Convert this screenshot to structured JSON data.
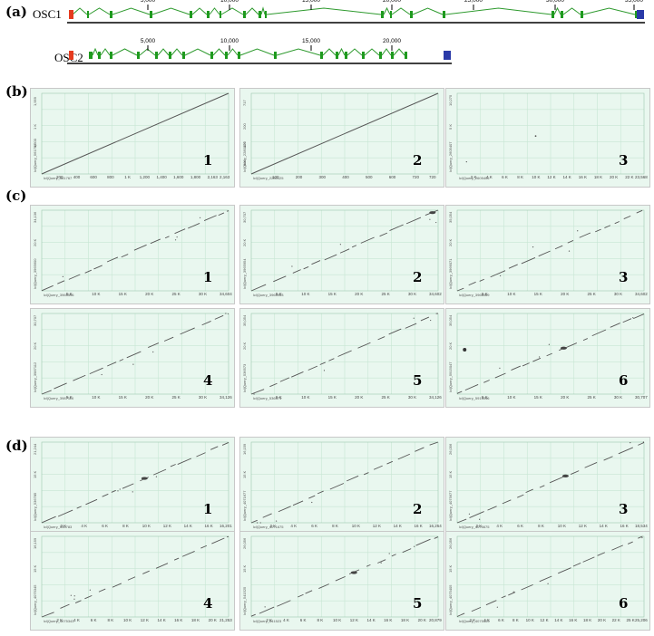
{
  "panels": {
    "a": "(a)",
    "b": "(b)",
    "c": "(c)",
    "d": "(d)"
  },
  "colors": {
    "exon": "#1e9a1e",
    "intron": "#2e9a2e",
    "start": "#e53a1e",
    "end": "#2a3aa8",
    "plot_bg": "#e9f7ef",
    "grid": "#c7e6d3",
    "line": "#555555"
  },
  "genes": [
    {
      "name": "OSC1",
      "ticks": [
        "5,000",
        "10,000",
        "15,000",
        "20,000",
        "25,000",
        "30,000",
        "35,000"
      ]
    },
    {
      "name": "OSC2",
      "ticks": [
        "5,000",
        "10,000",
        "15,000",
        "20,000"
      ]
    }
  ],
  "dotplots": {
    "b": [
      {
        "num": "1",
        "xlabel": "lcl|Query_561767",
        "ylabel": "lcl|Query_561768",
        "xmax": "2,163",
        "ymax": "1,959",
        "xticks": [
          "200",
          "400",
          "600",
          "800",
          "1 K",
          "1,200",
          "1,400",
          "1,600",
          "1,800",
          "2,163"
        ],
        "yticks": [
          "1 K",
          "1,500"
        ],
        "type": "diag"
      },
      {
        "num": "2",
        "xlabel": "lcl|Query_2280125",
        "ylabel": "lcl|Query_2280127",
        "xmax": "720",
        "ymax": "717",
        "xticks": [
          "100",
          "200",
          "300",
          "400",
          "500",
          "600",
          "720"
        ],
        "yticks": [
          "200",
          "400",
          "600"
        ],
        "type": "diag"
      },
      {
        "num": "3",
        "xlabel": "lcl|Query_2605406",
        "ylabel": "lcl|Query_2605407",
        "xmax": "23,568",
        "ymax": "10,275",
        "xticks": [
          "2 K",
          "4 K",
          "6 K",
          "8 K",
          "10 K",
          "12 K",
          "14 K",
          "16 K",
          "18 K",
          "20 K",
          "22 K"
        ],
        "yticks": [
          "5 K"
        ],
        "type": "sparse"
      }
    ],
    "c": [
      {
        "num": "1",
        "xlabel": "lcl|Query_3965596",
        "ylabel": "lcl|Query_3965600",
        "xmax": "34,604",
        "ymax": "34,136",
        "xticks": [
          "5 K",
          "10 K",
          "15 K",
          "20 K",
          "25 K",
          "30 K"
        ],
        "yticks": [
          "20 K"
        ],
        "type": "frag"
      },
      {
        "num": "2",
        "xlabel": "lcl|Query_3965953",
        "ylabel": "lcl|Query_3965954",
        "xmax": "34,602",
        "ymax": "30,707",
        "xticks": [
          "5 K",
          "10 K",
          "15 K",
          "20 K",
          "25 K",
          "30 K"
        ],
        "yticks": [
          "20 K"
        ],
        "type": "frag"
      },
      {
        "num": "3",
        "xlabel": "lcl|Query_3966069",
        "ylabel": "lcl|Query_3966071",
        "xmax": "34,602",
        "ymax": "35,054",
        "xticks": [
          "5 K",
          "10 K",
          "15 K",
          "20 K",
          "25 K",
          "30 K"
        ],
        "yticks": [
          "20 K"
        ],
        "type": "frag"
      },
      {
        "num": "4",
        "xlabel": "lcl|Query_3987110",
        "ylabel": "lcl|Query_3987112",
        "xmax": "34,126",
        "ymax": "30,707",
        "xticks": [
          "5 K",
          "10 K",
          "15 K",
          "20 K",
          "25 K",
          "30 K"
        ],
        "yticks": [
          "20 K"
        ],
        "type": "frag"
      },
      {
        "num": "5",
        "xlabel": "lcl|Query_536571",
        "ylabel": "lcl|Query_536573",
        "xmax": "34,126",
        "ymax": "35,054",
        "xticks": [
          "5 K",
          "10 K",
          "15 K",
          "20 K",
          "25 K",
          "30 K"
        ],
        "yticks": [
          "20 K"
        ],
        "type": "frag"
      },
      {
        "num": "6",
        "xlabel": "lcl|Query_5915046",
        "ylabel": "lcl|Query_5915047",
        "xmax": "30,707",
        "ymax": "35,054",
        "xticks": [
          "5 K",
          "10 K",
          "15 K",
          "20 K",
          "25 K",
          "30 K"
        ],
        "yticks": [
          "20 K"
        ],
        "type": "frag"
      }
    ],
    "d": [
      {
        "num": "1",
        "xlabel": "lcl|Query_536783",
        "ylabel": "lcl|Query_536785",
        "xmax": "16,201",
        "ymax": "21,244",
        "xticks": [
          "2 K",
          "4 K",
          "6 K",
          "8 K",
          "10 K",
          "12 K",
          "14 K",
          "16 K"
        ],
        "yticks": [
          "15 K"
        ],
        "type": "frag2"
      },
      {
        "num": "2",
        "xlabel": "lcl|Query_4071675",
        "ylabel": "lcl|Query_4071677",
        "xmax": "16,254",
        "ymax": "16,159",
        "xticks": [
          "2 K",
          "4 K",
          "6 K",
          "8 K",
          "10 K",
          "12 K",
          "14 K",
          "16 K"
        ],
        "yticks": [
          "15 K"
        ],
        "type": "frag2"
      },
      {
        "num": "3",
        "xlabel": "lcl|Query_4075675",
        "ylabel": "lcl|Query_4075677",
        "xmax": "18,534",
        "ymax": "26,056",
        "xticks": [
          "2 K",
          "4 K",
          "6 K",
          "8 K",
          "10 K",
          "12 K",
          "14 K",
          "16 K"
        ],
        "yticks": [
          "15 K"
        ],
        "type": "frag2"
      },
      {
        "num": "4",
        "xlabel": "lcl|Query_4075343",
        "ylabel": "lcl|Query_4075345",
        "xmax": "21,253",
        "ymax": "16,159",
        "xticks": [
          "2 K",
          "4 K",
          "6 K",
          "8 K",
          "10 K",
          "12 K",
          "14 K",
          "16 K",
          "18 K",
          "20 K"
        ],
        "yticks": [
          "15 K"
        ],
        "type": "frag2"
      },
      {
        "num": "5",
        "xlabel": "lcl|Query_541523",
        "ylabel": "lcl|Query_541525",
        "xmax": "20,879",
        "ymax": "26,056",
        "xticks": [
          "2 K",
          "4 K",
          "6 K",
          "8 K",
          "10 K",
          "12 K",
          "14 K",
          "16 K",
          "18 K",
          "20 K"
        ],
        "yticks": [
          "15 K"
        ],
        "type": "frag2"
      },
      {
        "num": "6",
        "xlabel": "lcl|Query_4075403",
        "ylabel": "lcl|Query_4075405",
        "xmax": "25,206",
        "ymax": "26,056",
        "xticks": [
          "2 K",
          "4 K",
          "6 K",
          "8 K",
          "10 K",
          "12 K",
          "14 K",
          "16 K",
          "18 K",
          "20 K",
          "22 K",
          "25 K"
        ],
        "yticks": [
          "15 K"
        ],
        "type": "frag2"
      }
    ]
  }
}
